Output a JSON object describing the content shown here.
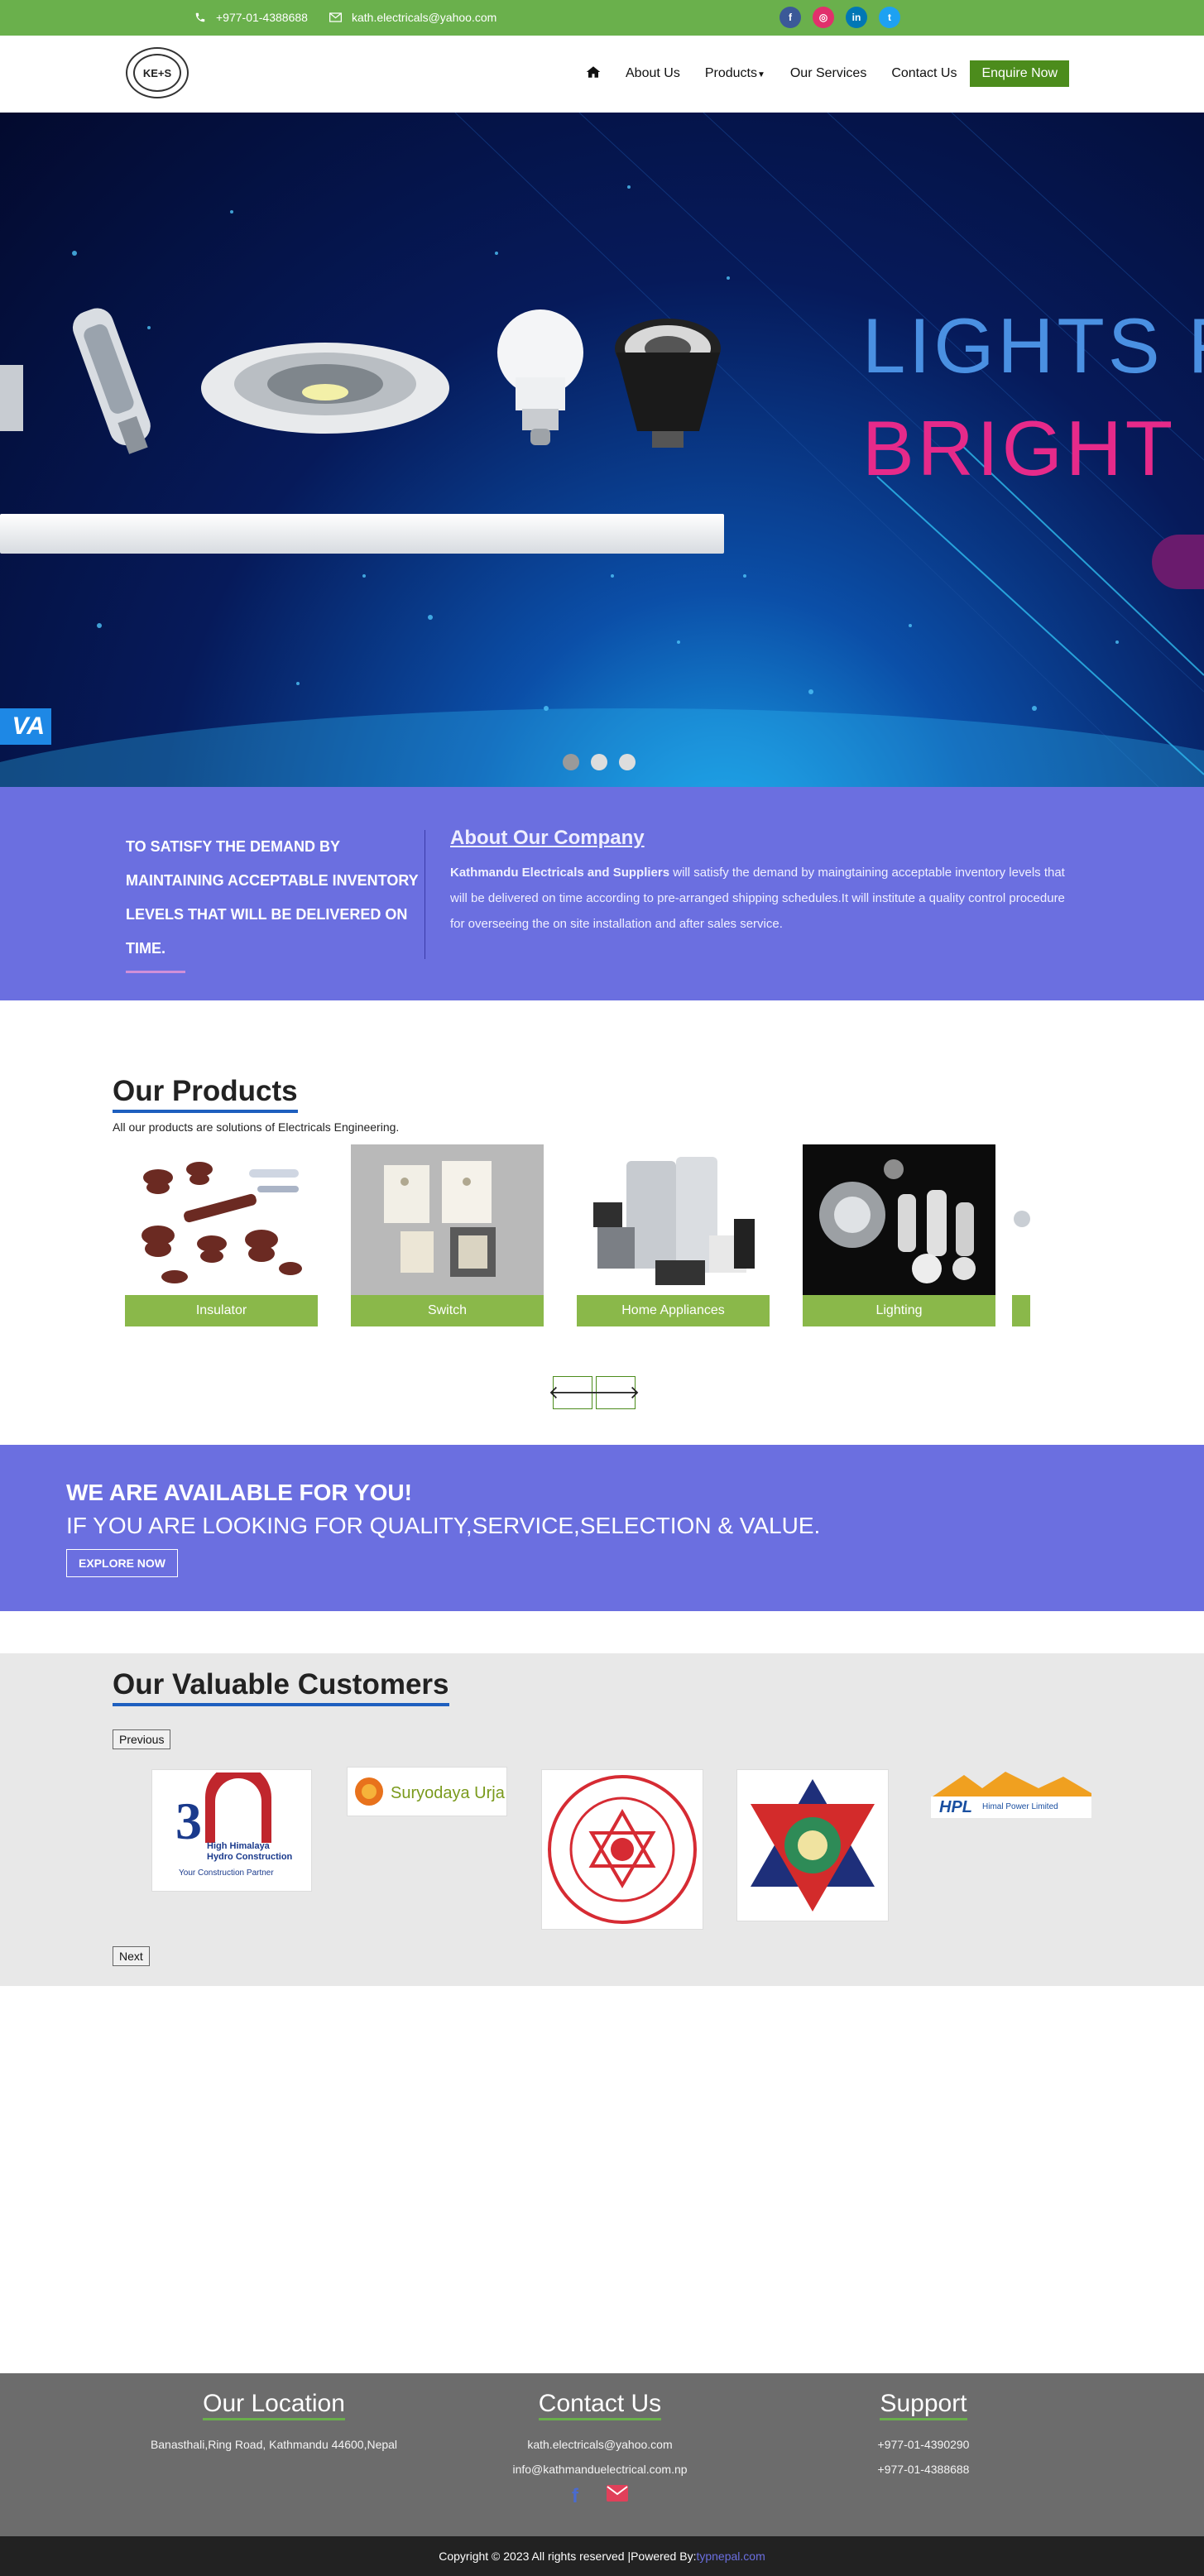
{
  "topbar": {
    "phone": "+977-01-4388688",
    "email": "kath.electricals@yahoo.com",
    "social": [
      "f",
      "ig",
      "in",
      "tw"
    ]
  },
  "nav": {
    "logo_text": "KE+S",
    "links": [
      "About Us",
      "Products",
      "Our Services",
      "Contact Us"
    ],
    "cta": "Enquire Now"
  },
  "hero": {
    "line1": "LIGHTS F",
    "line2": "BRIGHT",
    "brand": "VA",
    "slides": 3,
    "active_slide": 0
  },
  "about": {
    "tagline": "TO SATISFY THE DEMAND BY MAINTAINING ACCEPTABLE INVENTORY LEVELS THAT WILL BE DELIVERED ON TIME.",
    "title": "About Our Company",
    "company": "Kathmandu Electricals and Suppliers",
    "text": " will satisfy the demand by maingtaining acceptable inventory levels that will be delivered on time according to pre-arranged shipping schedules.It will institute a quality control procedure for overseeing the on site installation and after sales service."
  },
  "products": {
    "title": "Our Products",
    "subtitle": "All our products are solutions of Electricals Engineering.",
    "items": [
      "Insulator",
      "Switch",
      "Home Appliances",
      "Lighting"
    ]
  },
  "available": {
    "line1": "WE ARE AVAILABLE FOR YOU!",
    "line2": "IF YOU ARE LOOKING FOR QUALITY,SERVICE,SELECTION & VALUE.",
    "button": "EXPLORE NOW"
  },
  "customers": {
    "title": "Our Valuable Customers",
    "prev": "Previous",
    "next": "Next",
    "logos": [
      {
        "text": "High Himalaya Hydro Construction",
        "sub": "Your Construction Partner"
      },
      {
        "text": "Suryodaya Urja"
      },
      {
        "text": "Kathmandu Metropolitan City"
      },
      {
        "text": "Nepal Government Emblem"
      },
      {
        "text": "HPL",
        "sub": "Himal Power Limited"
      }
    ]
  },
  "footer": {
    "location_title": "Our Location",
    "address": "Banasthali,Ring Road, Kathmandu 44600,Nepal",
    "contact_title": "Contact Us",
    "contact_email1": "kath.electricals@yahoo.com",
    "contact_email2": "info@kathmanduelectrical.com.np",
    "support_title": "Support",
    "support_phone1": "+977-01-4390290",
    "support_phone2": "+977-01-4388688",
    "copyright": "Copyright © 2023 All rights reserved |Powered By:",
    "powered": "typnepal.com"
  },
  "colors": {
    "green": "#6ab04c",
    "purple": "#6b6fe0",
    "footer": "#6c6c6c"
  }
}
